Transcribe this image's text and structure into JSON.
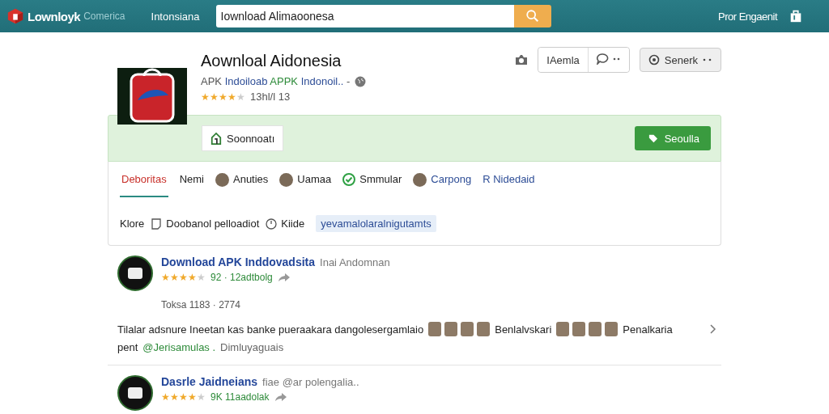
{
  "header": {
    "logo": "Lownloyk",
    "logo_sub": "Comerica",
    "nav": "Intonsiana",
    "search": {
      "value": "Iownload Alimaoonesa"
    },
    "account": "Pror Engaenit"
  },
  "app": {
    "title": "Aownloal Aidonesia",
    "subtitle": [
      {
        "text": "APK",
        "kind": "muted"
      },
      {
        "text": "Indoiloab",
        "kind": "link"
      },
      {
        "text": "APPK",
        "kind": "accent"
      },
      {
        "text": "Indonoil..",
        "kind": "link"
      },
      {
        "text": "-",
        "kind": "muted"
      }
    ],
    "rating": {
      "stars": 4,
      "count": "13hl/l 13"
    },
    "actions": {
      "group_label": "IAemla",
      "button": "Senerk"
    },
    "panel": {
      "left_button": "Soonnoatı",
      "right_button": "Seoulla"
    }
  },
  "tabs": [
    {
      "label": "Deboritas",
      "kind": "plain",
      "selected": true
    },
    {
      "label": "Nemi",
      "kind": "plain",
      "selected": false
    },
    {
      "label": "Anuties",
      "kind": "avatar",
      "selected": false
    },
    {
      "label": "Uamaa",
      "kind": "avatar",
      "selected": false
    },
    {
      "label": "Smmular",
      "kind": "check",
      "selected": false
    },
    {
      "label": "Carpong",
      "kind": "avatar",
      "selected": false
    },
    {
      "label": "R Nidedaid",
      "kind": "plain",
      "selected": false
    }
  ],
  "filters": {
    "label": "Klore",
    "items": [
      {
        "label": "Doobanol pelloadiot",
        "kind": "note"
      },
      {
        "label": "Kiide",
        "kind": "clock"
      }
    ],
    "chip": "yevamalolaralnigutamts"
  },
  "results": [
    {
      "title": "Download APK Inddovadsita",
      "source": "Inai Andomnan",
      "stars": 4,
      "rating": "92 · 12adtbolg",
      "meta": "Toksa 1183 · 2774",
      "description": [
        {
          "kind": "text",
          "text": "Tilalar adsnure Ineetan kas banke pueraakara dangolesergamlaio"
        },
        {
          "kind": "avatars"
        },
        {
          "kind": "text",
          "text": "Benlalvskari"
        },
        {
          "kind": "avatars"
        },
        {
          "kind": "text",
          "text": "Penalkaria"
        }
      ],
      "second_line": [
        {
          "kind": "text",
          "text": "pent"
        },
        {
          "kind": "mention",
          "text": "@Jerisamulas ."
        },
        {
          "kind": "muted",
          "text": "Dimluyaguais"
        }
      ]
    },
    {
      "title": "Dasrle Jaidneians",
      "source": "fiae @ar polengalia..",
      "stars": 4,
      "rating": "9K 11aadolak"
    }
  ]
}
